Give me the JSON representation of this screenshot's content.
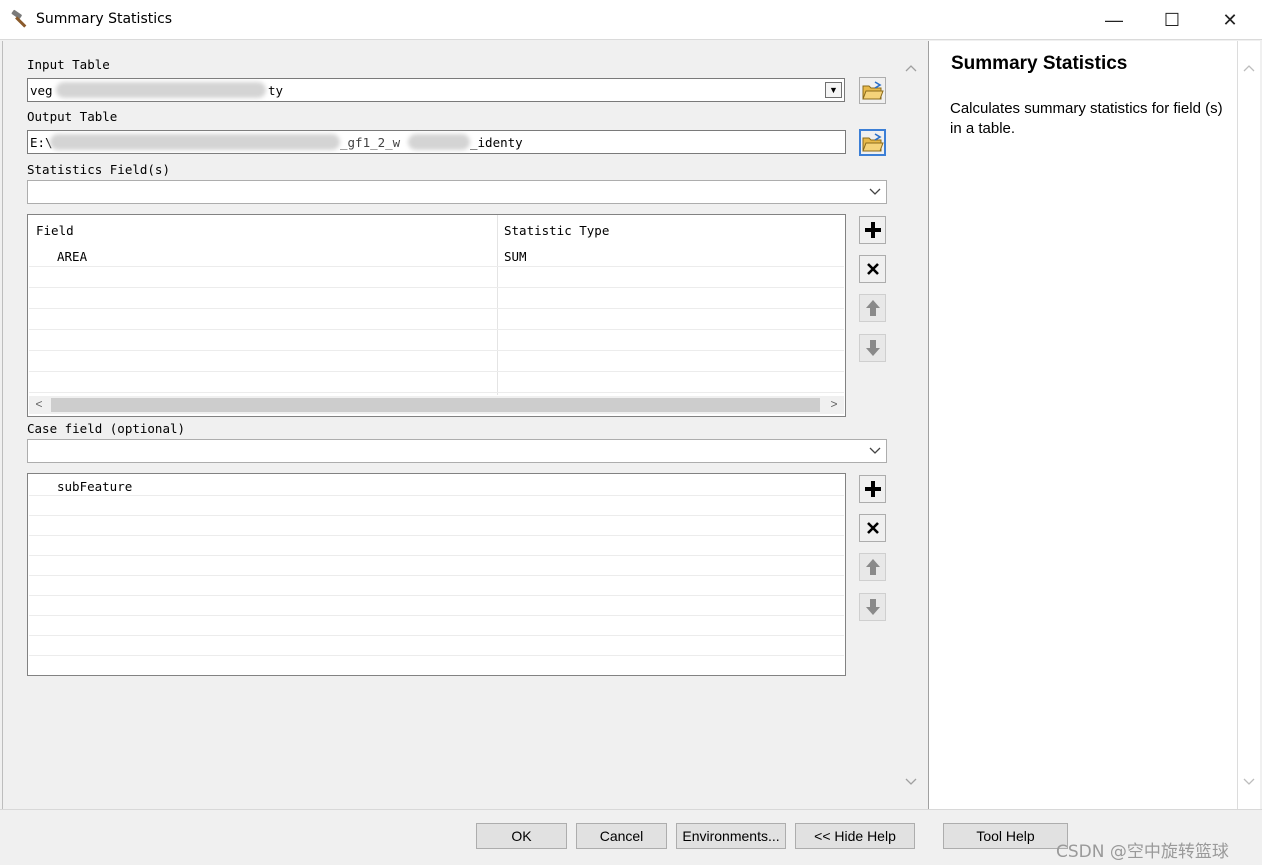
{
  "window": {
    "title": "Summary Statistics",
    "min_glyph": "—",
    "max_glyph": "☐",
    "close_glyph": "✕"
  },
  "form": {
    "input_table_label": "Input Table",
    "input_table_value_start": "veg",
    "input_table_value_end": "ty",
    "output_table_label": "Output Table",
    "output_table_value_start": "E:\\",
    "output_table_value_mid": "_gf1_2_w",
    "output_table_value_end": "_identy",
    "statistics_fields_label": "Statistics Field(s)",
    "stats_grid": {
      "columns": [
        "Field",
        "Statistic Type"
      ],
      "rows": [
        [
          "AREA",
          "SUM"
        ]
      ]
    },
    "case_field_label": "Case field (optional)",
    "case_grid": {
      "rows": [
        "subFeature"
      ]
    }
  },
  "help": {
    "title": "Summary Statistics",
    "description": "Calculates summary statistics for field (s) in a table."
  },
  "buttons": {
    "ok": "OK",
    "cancel": "Cancel",
    "environments": "Environments...",
    "hide_help": "<< Hide Help",
    "tool_help": "Tool Help"
  },
  "watermark": "CSDN @空中旋转篮球",
  "icons": {
    "app": "hammer-icon",
    "browse": "open-folder-icon",
    "add": "plus-icon",
    "remove": "x-icon",
    "up": "arrow-up-icon",
    "down": "arrow-down-icon"
  }
}
